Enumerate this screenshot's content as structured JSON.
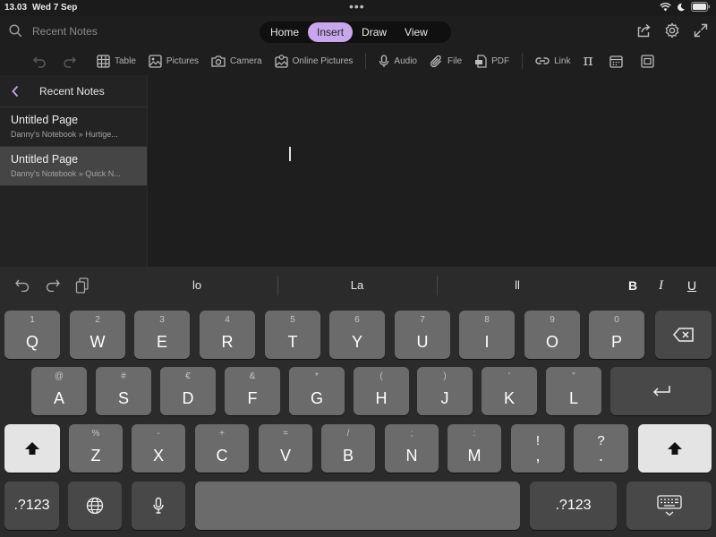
{
  "status": {
    "time": "13.03",
    "date": "Wed 7 Sep",
    "dots": "•••"
  },
  "topbar": {
    "search_label": "Recent Notes",
    "tabs": [
      {
        "label": "Home"
      },
      {
        "label": "Insert",
        "active": true
      },
      {
        "label": "Draw"
      },
      {
        "label": "View"
      }
    ]
  },
  "ribbon": {
    "items": [
      {
        "label": "Table",
        "icon": "table-icon"
      },
      {
        "label": "Pictures",
        "icon": "pictures-icon"
      },
      {
        "label": "Camera",
        "icon": "camera-icon"
      },
      {
        "label": "Online Pictures",
        "icon": "online-pictures-icon"
      },
      {
        "label": "Audio",
        "icon": "microphone-icon"
      },
      {
        "label": "File",
        "icon": "paperclip-icon"
      },
      {
        "label": "PDF",
        "icon": "pdf-icon"
      },
      {
        "label": "Link",
        "icon": "link-icon"
      }
    ],
    "equation_symbol": "π"
  },
  "sidebar": {
    "title": "Recent Notes",
    "pages": [
      {
        "title": "Untitled Page",
        "path": "Danny's Notebook » Hurtige..."
      },
      {
        "title": "Untitled Page",
        "path": "Danny's Notebook » Quick N...",
        "selected": true
      }
    ]
  },
  "keyboard": {
    "suggestions": [
      "lo",
      "La",
      "ll"
    ],
    "format": {
      "bold": "B",
      "italic": "I",
      "underline": "U"
    },
    "row1": [
      {
        "sec": "1",
        "pri": "Q"
      },
      {
        "sec": "2",
        "pri": "W"
      },
      {
        "sec": "3",
        "pri": "E"
      },
      {
        "sec": "4",
        "pri": "R"
      },
      {
        "sec": "5",
        "pri": "T"
      },
      {
        "sec": "6",
        "pri": "Y"
      },
      {
        "sec": "7",
        "pri": "U"
      },
      {
        "sec": "8",
        "pri": "I"
      },
      {
        "sec": "9",
        "pri": "O"
      },
      {
        "sec": "0",
        "pri": "P"
      }
    ],
    "row2": [
      {
        "sec": "@",
        "pri": "A"
      },
      {
        "sec": "#",
        "pri": "S"
      },
      {
        "sec": "€",
        "pri": "D"
      },
      {
        "sec": "&",
        "pri": "F"
      },
      {
        "sec": "*",
        "pri": "G"
      },
      {
        "sec": "(",
        "pri": "H"
      },
      {
        "sec": ")",
        "pri": "J"
      },
      {
        "sec": "'",
        "pri": "K"
      },
      {
        "sec": "\"",
        "pri": "L"
      }
    ],
    "row3": [
      {
        "sec": "%",
        "pri": "Z"
      },
      {
        "sec": "-",
        "pri": "X"
      },
      {
        "sec": "+",
        "pri": "C"
      },
      {
        "sec": "=",
        "pri": "V"
      },
      {
        "sec": "/",
        "pri": "B"
      },
      {
        "sec": ";",
        "pri": "N"
      },
      {
        "sec": ":",
        "pri": "M"
      },
      {
        "sec": "!",
        "pri": ","
      },
      {
        "sec": "?",
        "pri": "."
      }
    ],
    "numbers_label": ".?123"
  }
}
